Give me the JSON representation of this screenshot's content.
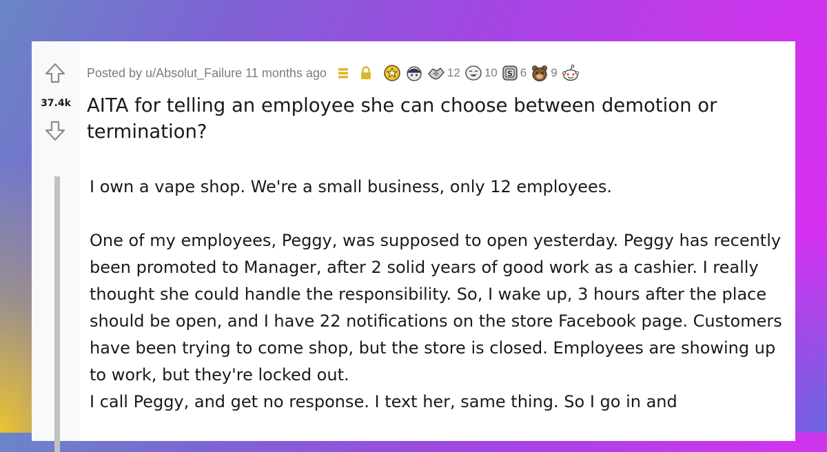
{
  "post": {
    "score": "37.4k",
    "meta": {
      "posted_by": "Posted by u/Absolut_Failure 11 months ago"
    },
    "awards": [
      {
        "icon": "gold-medal-award-icon",
        "count": ""
      },
      {
        "icon": "helmet-face-award-icon",
        "count": ""
      },
      {
        "icon": "silver-handshake-award-icon",
        "count": "12"
      },
      {
        "icon": "laughing-face-award-icon",
        "count": "10"
      },
      {
        "icon": "silver-coin-award-icon",
        "count": "6"
      },
      {
        "icon": "bear-award-icon",
        "count": "9"
      },
      {
        "icon": "snoo-award-icon",
        "count": ""
      }
    ],
    "title": "AITA for telling an employee she can choose between demotion or termination?",
    "body": {
      "p1": "I own a vape shop. We're a small business, only 12 employees.",
      "p2": "One of my employees, Peggy, was supposed to open yesterday. Peggy has recently been promoted to Manager, after 2 solid years of good work as a cashier. I really thought she could handle the responsibility. So, I wake up, 3 hours after the place should be open, and I have 22 notifications on the store Facebook page. Customers have been trying to come shop, but the store is closed. Employees are showing up to work, but they're locked out.",
      "p3": "I call Peggy, and get no response. I text her, same thing. So I go in and"
    }
  },
  "colors": {
    "upvote_arrow": "#878a8c",
    "text": "#1a1a1b",
    "meta": "#7c7c7c",
    "mod_badge": "#dfb52a",
    "quote_bar": "#c2c2c2"
  }
}
